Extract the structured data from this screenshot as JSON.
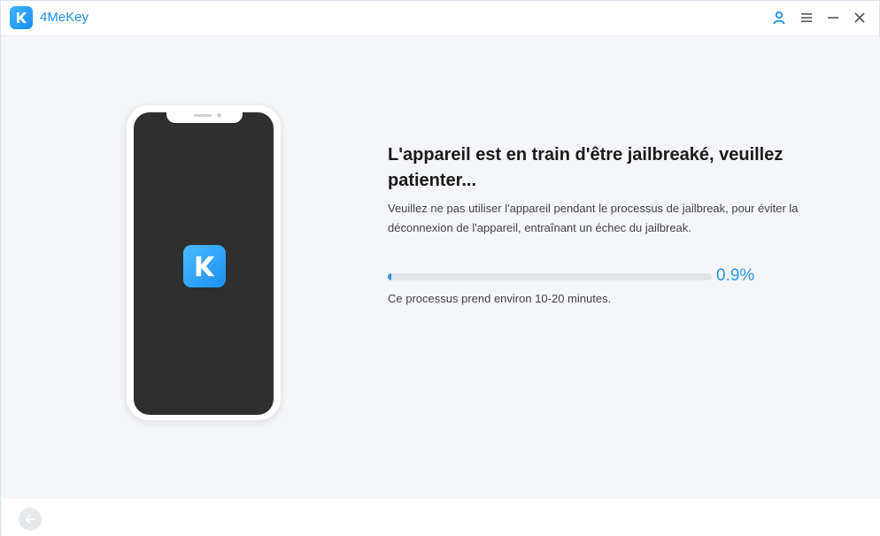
{
  "app": {
    "name": "4MeKey",
    "accent": "#1e8de6"
  },
  "titlebar": {
    "icons": [
      "user-icon",
      "menu-icon",
      "minimize-icon",
      "close-icon"
    ]
  },
  "main": {
    "title": "L'appareil est en train d'être jailbreaké, veuillez patienter...",
    "description": "Veuillez ne pas utiliser l'appareil pendant le processus de jailbreak, pour éviter la déconnexion de l'appareil, entraînant un échec du jailbreak.",
    "progress": {
      "fraction": 0.009,
      "label": "0.9%"
    },
    "note": "Ce processus prend environ 10-20 minutes."
  },
  "footer": {
    "back_icon": "arrow-left-icon"
  }
}
